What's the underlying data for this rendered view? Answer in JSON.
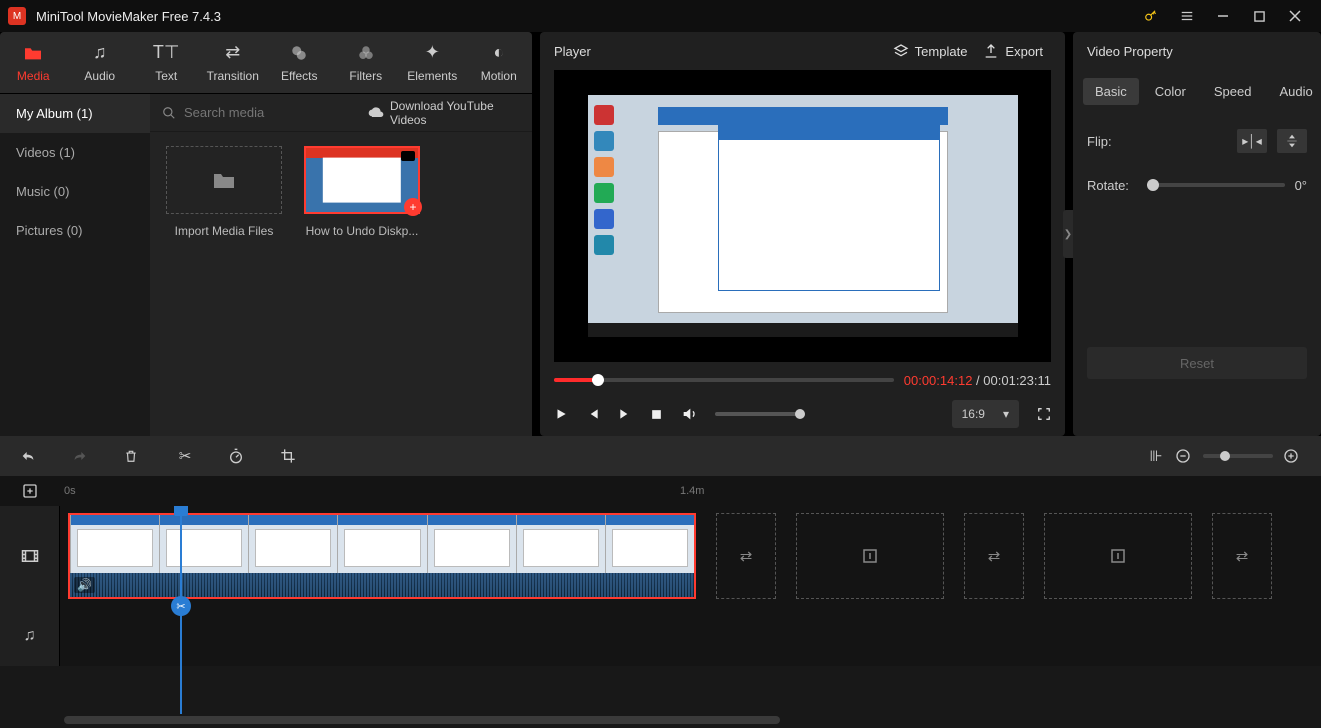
{
  "app": {
    "title": "MiniTool MovieMaker Free 7.4.3"
  },
  "tabs": {
    "media": "Media",
    "audio": "Audio",
    "text": "Text",
    "transition": "Transition",
    "effects": "Effects",
    "filters": "Filters",
    "elements": "Elements",
    "motion": "Motion"
  },
  "sidebar": {
    "myalbum": "My Album (1)",
    "videos": "Videos (1)",
    "music": "Music (0)",
    "pictures": "Pictures (0)"
  },
  "media": {
    "search_placeholder": "Search media",
    "youtube": "Download YouTube Videos",
    "import": "Import Media Files",
    "clip1": "How to Undo Diskp..."
  },
  "player": {
    "title": "Player",
    "template": "Template",
    "export": "Export",
    "current": "00:00:14:12",
    "sep": " / ",
    "total": "00:01:23:11",
    "aspect": "16:9"
  },
  "props": {
    "title": "Video Property",
    "basic": "Basic",
    "color": "Color",
    "speed": "Speed",
    "audio": "Audio",
    "flip": "Flip:",
    "rotate": "Rotate:",
    "deg": "0°",
    "reset": "Reset"
  },
  "timeline": {
    "start": "0s",
    "mid": "1.4m"
  }
}
